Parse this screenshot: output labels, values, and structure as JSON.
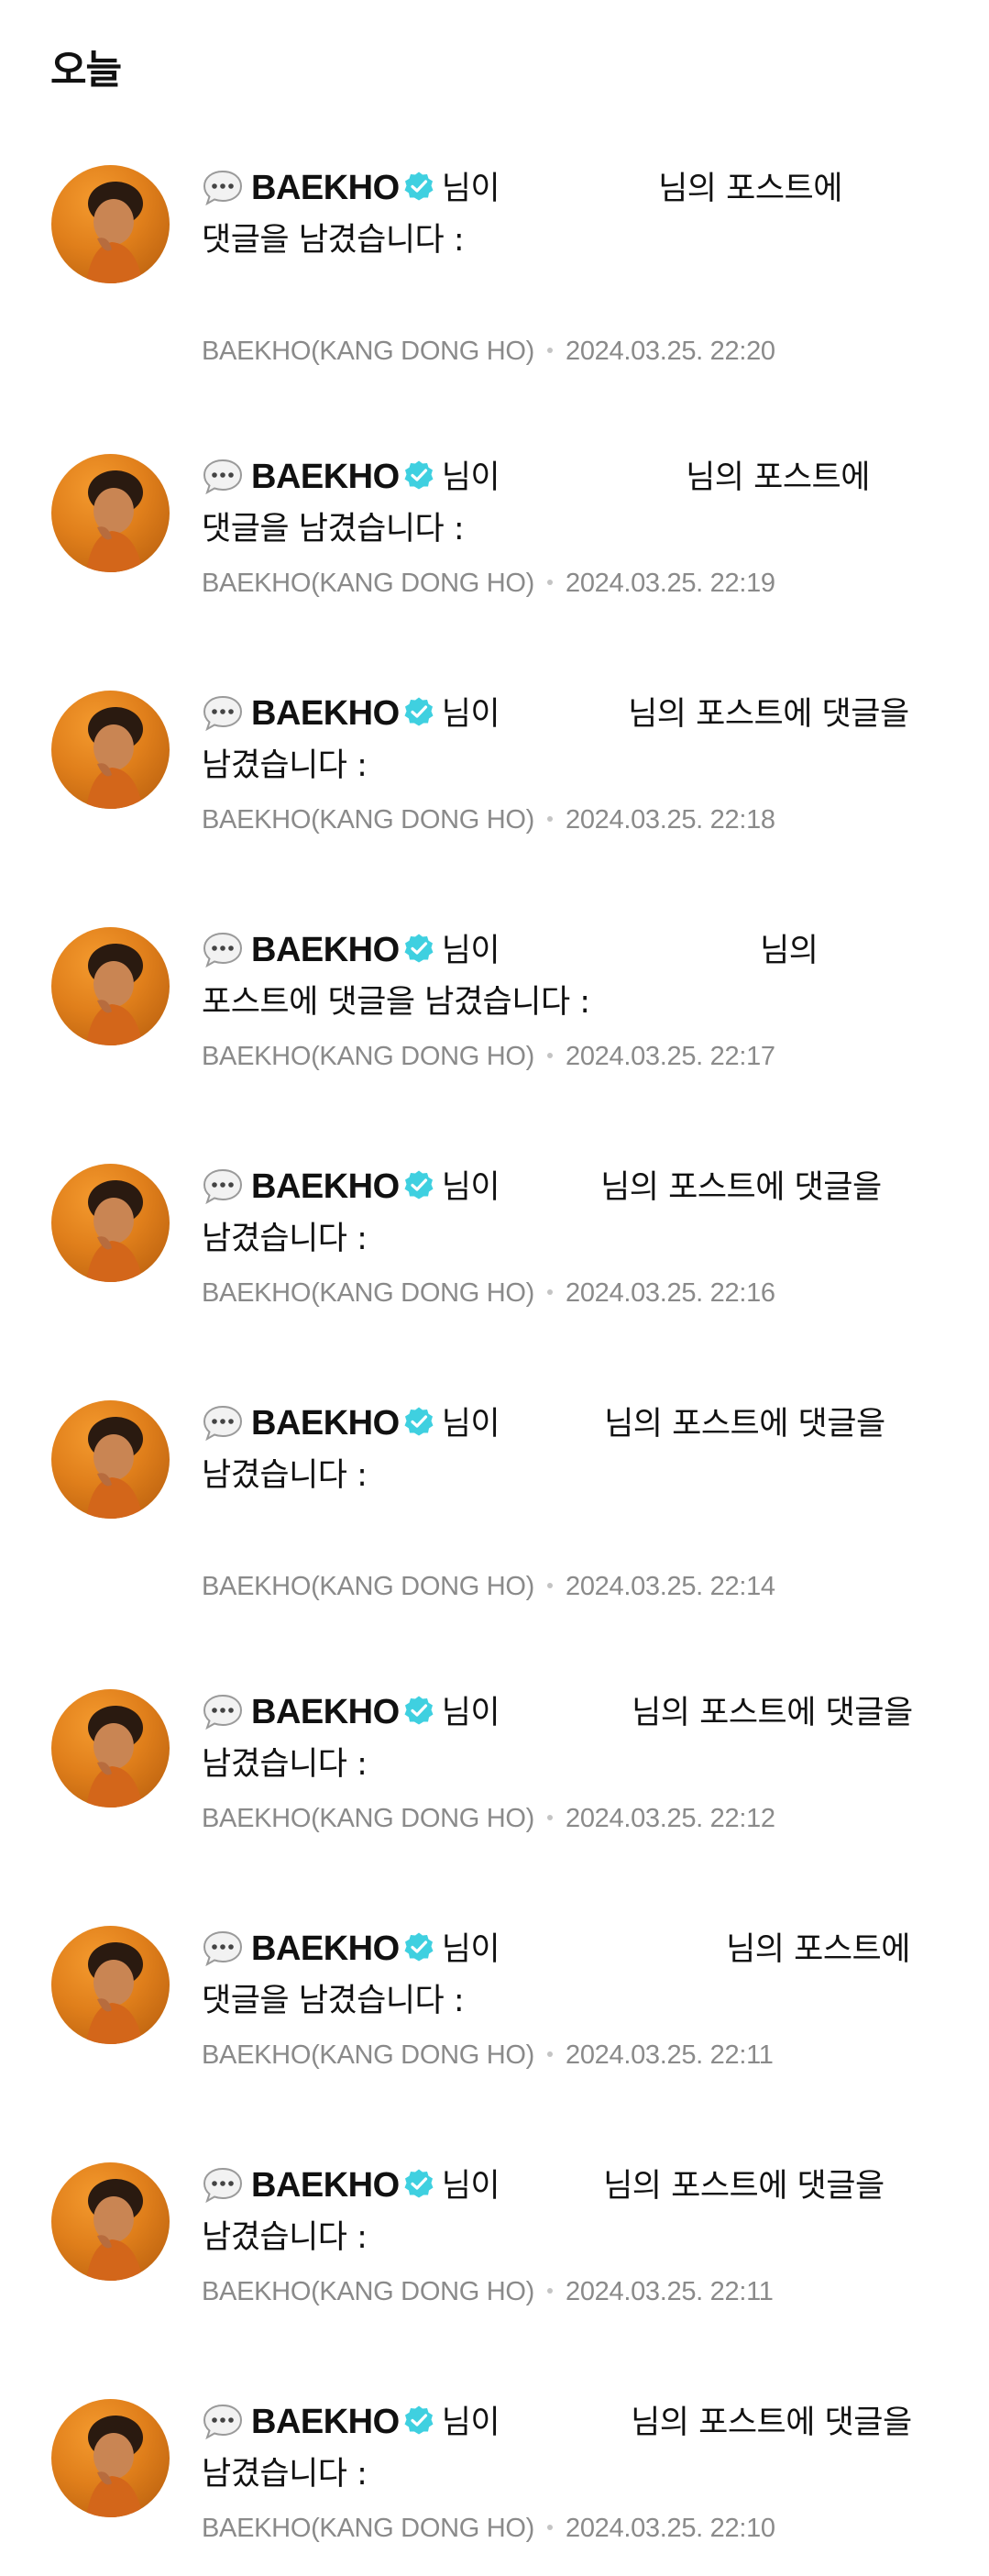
{
  "section": {
    "title": "오늘"
  },
  "icons": {
    "bubble": "speech-bubble-icon",
    "verified": "verified-badge-icon",
    "verified_color": "#3fd0e0"
  },
  "notifications": [
    {
      "username": "BAEKHO",
      "text_a": "님이",
      "text_b": "님의 포스트에",
      "text_c": "댓글을 남겼습니다 :",
      "author": "BAEKHO(KANG DONG HO)",
      "time": "2024.03.25. 22:20"
    },
    {
      "username": "BAEKHO",
      "text_a": "님이",
      "text_b": "님의 포스트에",
      "text_c": "댓글을 남겼습니다 :",
      "author": "BAEKHO(KANG DONG HO)",
      "time": "2024.03.25. 22:19"
    },
    {
      "username": "BAEKHO",
      "text_a": "님이",
      "text_b": "님의 포스트에 댓글을",
      "text_c": "남겼습니다 :",
      "author": "BAEKHO(KANG DONG HO)",
      "time": "2024.03.25. 22:18"
    },
    {
      "username": "BAEKHO",
      "text_a": "님이",
      "text_b": "님의",
      "text_c": "포스트에 댓글을 남겼습니다 :",
      "author": "BAEKHO(KANG DONG HO)",
      "time": "2024.03.25. 22:17"
    },
    {
      "username": "BAEKHO",
      "text_a": "님이",
      "text_b": "님의 포스트에 댓글을",
      "text_c": "남겼습니다 :",
      "author": "BAEKHO(KANG DONG HO)",
      "time": "2024.03.25. 22:16"
    },
    {
      "username": "BAEKHO",
      "text_a": "님이",
      "text_b": "님의 포스트에 댓글을",
      "text_c": "남겼습니다 :",
      "author": "BAEKHO(KANG DONG HO)",
      "time": "2024.03.25. 22:14"
    },
    {
      "username": "BAEKHO",
      "text_a": "님이",
      "text_b": "님의 포스트에 댓글을",
      "text_c": "남겼습니다 :",
      "author": "BAEKHO(KANG DONG HO)",
      "time": "2024.03.25. 22:12"
    },
    {
      "username": "BAEKHO",
      "text_a": "님이",
      "text_b": "님의 포스트에",
      "text_c": "댓글을 남겼습니다 :",
      "author": "BAEKHO(KANG DONG HO)",
      "time": "2024.03.25. 22:11"
    },
    {
      "username": "BAEKHO",
      "text_a": "님이",
      "text_b": "님의 포스트에 댓글을",
      "text_c": "남겼습니다 :",
      "author": "BAEKHO(KANG DONG HO)",
      "time": "2024.03.25. 22:11"
    },
    {
      "username": "BAEKHO",
      "text_a": "님이",
      "text_b": "님의 포스트에 댓글을",
      "text_c": "남겼습니다 :",
      "author": "BAEKHO(KANG DONG HO)",
      "time": "2024.03.25. 22:10"
    }
  ]
}
